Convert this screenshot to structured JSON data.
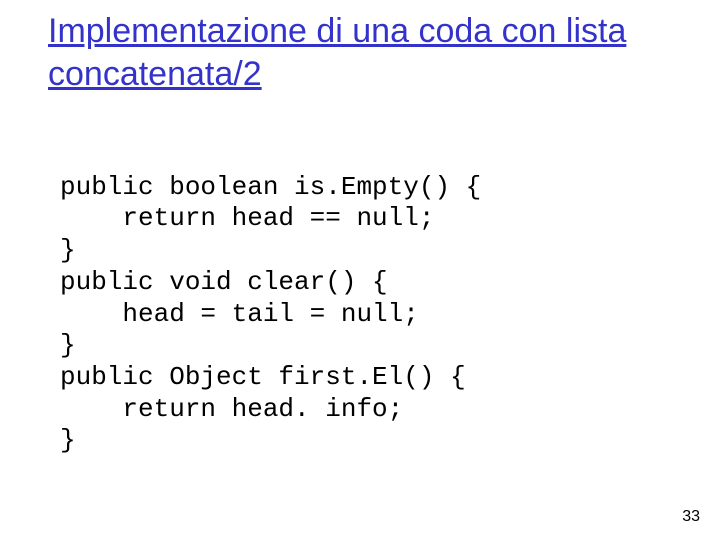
{
  "title": "Implementazione di una coda con lista concatenata/2",
  "code": {
    "l0": "public boolean is.Empty() {",
    "l1": "    return head == null;",
    "l2": "}",
    "l3": "public void clear() {",
    "l4": "    head = tail = null;",
    "l5": "}",
    "l6": "public Object first.El() {",
    "l7": "    return head. info;",
    "l8": "}"
  },
  "page_number": "33"
}
